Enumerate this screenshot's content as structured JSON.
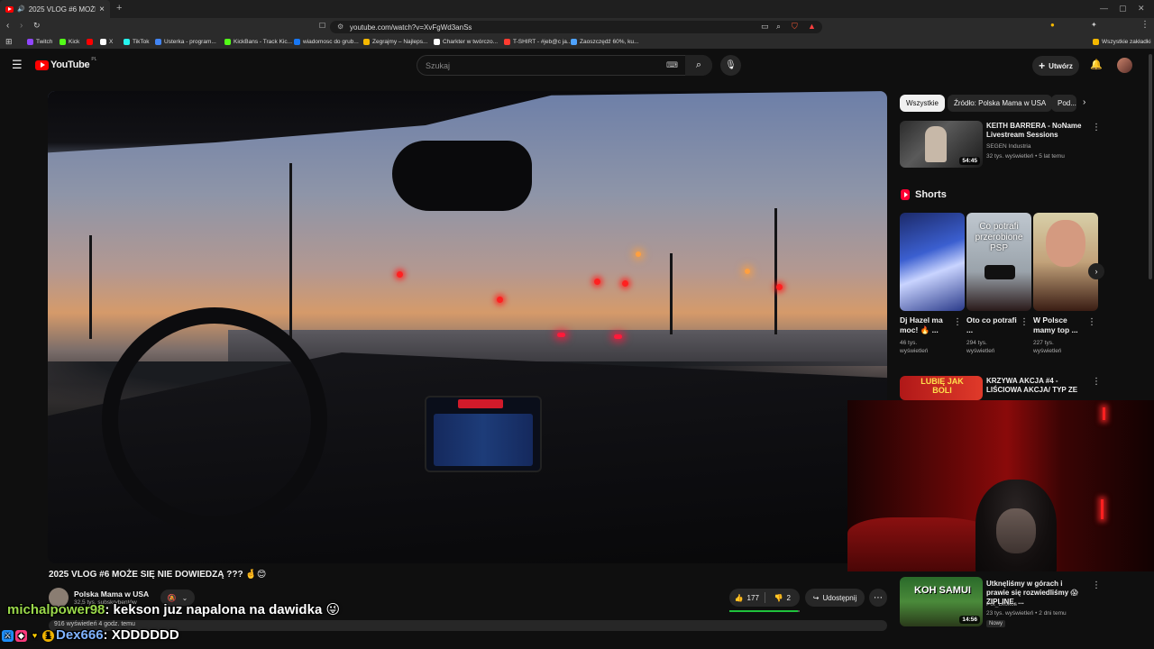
{
  "browser": {
    "tab_title": "2025 VLOG #6 MOŻE SIĘ NIE...",
    "tab_close": "×",
    "new_tab": "+",
    "url": "youtube.com/watch?v=XvFgWd3anSs",
    "window_controls": [
      "—",
      "▢",
      "✕"
    ],
    "bookmarks": [
      {
        "label": "Twitch",
        "color": "#9146ff"
      },
      {
        "label": "Kick",
        "color": "#53fc18"
      },
      {
        "label": "",
        "color": "#ff0000"
      },
      {
        "label": "X",
        "color": "#ffffff"
      },
      {
        "label": "TikTok",
        "color": "#ffffff"
      },
      {
        "label": "Usterka - program...",
        "color": "#4285f4"
      },
      {
        "label": "KickBans - Track Kic...",
        "color": "#53fc18"
      },
      {
        "label": "wiadomosc do grub...",
        "color": "#1877f2"
      },
      {
        "label": "Zegrajmy – Najleps...",
        "color": "#f5b800"
      },
      {
        "label": "Charkter w twórczo...",
        "color": "#ffffff"
      },
      {
        "label": "T-SHIRT - #jeb@c ja...",
        "color": "#ff3b30"
      },
      {
        "label": "Zaoszczędź 60%, ku...",
        "color": "#4fa3ff"
      }
    ],
    "all_bookmarks": "Wszystkie zakładki"
  },
  "youtube": {
    "logo_text": "YouTube",
    "logo_region": "PL",
    "search_placeholder": "Szukaj",
    "create_label": "Utwórz"
  },
  "video": {
    "title": "2025 VLOG #6 MOŻE SIĘ NIE DOWIEDZĄ ??? 🤞😊",
    "channel": "Polska Mama w USA",
    "subscribers": "32,5 tys. subskrybentów",
    "likes": "177",
    "dislikes": "2",
    "share_label": "Udostępnij",
    "like_ratio": 0.98,
    "description_preview": "916 wyświetleń  4 godz. temu"
  },
  "sidebar": {
    "chips": [
      "Wszystkie",
      "Źródło: Polska Mama w USA",
      "Pod..."
    ],
    "recommendations": [
      {
        "title": "KEITH BARRERA - NoName Livestream Sessions",
        "channel": "SEGEN Industria",
        "meta": "32 tys. wyświetleń • 5 lat temu",
        "duration": "54:45"
      },
      {
        "title": "KRZYWA AKCJA #4 - LIŚCIOWA AKCJA/ TYP ZE SNAPA/ ...",
        "channel": "",
        "meta": "",
        "duration": "",
        "thumb_text": "LUBIĘ JAK BOLI"
      },
      {
        "title": "Utknęliśmy w górach i prawie się rozwiedliśmy 😱 ZIPLINE, ...",
        "channel": "Pot_Lkokos",
        "meta": "23 tys. wyświetleń • 2 dni temu",
        "duration": "14:56",
        "badge": "Nowy",
        "thumb_text": "KOH SAMUI"
      }
    ],
    "shorts_label": "Shorts",
    "shorts": [
      {
        "title": "Dj Hazel ma moc! 🔥 ...",
        "views": "46 tys. wyświetleń"
      },
      {
        "title": "Oto co potrafi ...",
        "views": "294 tys. wyświetleń",
        "thumb_text": "Co potrafi przerobione PSP"
      },
      {
        "title": "W Polsce mamy top ...",
        "views": "227 tys. wyświetleń"
      }
    ]
  },
  "chat": [
    {
      "user": "michalpower98",
      "message": ": kekson juz napalona na dawidka 😜"
    },
    {
      "user": "Dex666",
      "message": ": XDDDDDD"
    }
  ]
}
